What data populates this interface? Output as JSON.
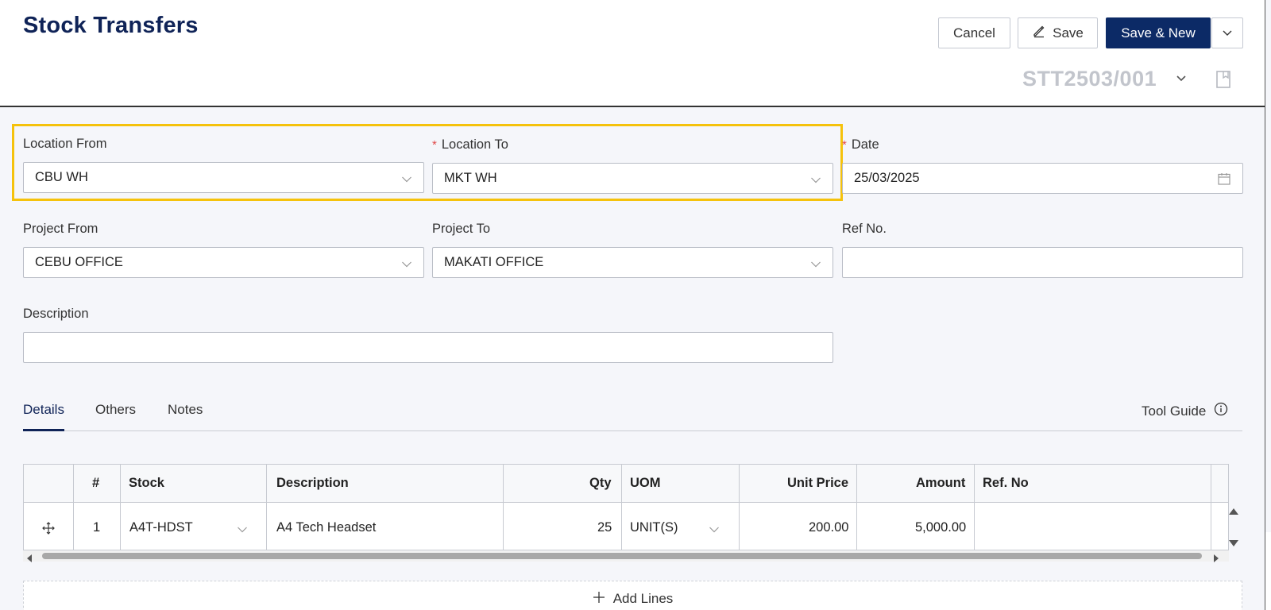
{
  "header": {
    "title": "Stock Transfers",
    "buttons": {
      "cancel": "Cancel",
      "save": "Save",
      "save_new": "Save & New"
    },
    "doc_number": "STT2503/001"
  },
  "form": {
    "location_from": {
      "label": "Location From",
      "value": "CBU WH",
      "required": false
    },
    "location_to": {
      "label": "Location To",
      "value": "MKT WH",
      "required": true
    },
    "date": {
      "label": "Date",
      "value": "25/03/2025",
      "required": true
    },
    "project_from": {
      "label": "Project From",
      "value": "CEBU OFFICE"
    },
    "project_to": {
      "label": "Project To",
      "value": "MAKATI OFFICE"
    },
    "ref_no": {
      "label": "Ref No.",
      "value": ""
    },
    "description": {
      "label": "Description",
      "value": ""
    },
    "required_mark": "*"
  },
  "tabs": [
    "Details",
    "Others",
    "Notes"
  ],
  "active_tab": "Details",
  "tool_guide": "Tool Guide",
  "grid": {
    "columns": [
      "#",
      "Stock",
      "Description",
      "Qty",
      "UOM",
      "Unit Price",
      "Amount",
      "Ref. No"
    ],
    "rows": [
      {
        "num": "1",
        "stock": "A4T-HDST",
        "description": "A4 Tech Headset",
        "qty": "25",
        "uom": "UNIT(S)",
        "unit_price": "200.00",
        "amount": "5,000.00",
        "ref_no": ""
      }
    ]
  },
  "add_lines": "Add Lines",
  "colors": {
    "primary": "#0c2a66",
    "title": "#0f2357",
    "highlight": "#f5c20c",
    "required": "#e04848"
  },
  "icons": [
    "pencil-icon",
    "chevron-down-icon",
    "bookmark-icon",
    "calendar-icon",
    "info-icon",
    "move-icon",
    "plus-icon",
    "triangle-up-icon",
    "triangle-down-icon",
    "triangle-left-icon",
    "triangle-right-icon"
  ]
}
